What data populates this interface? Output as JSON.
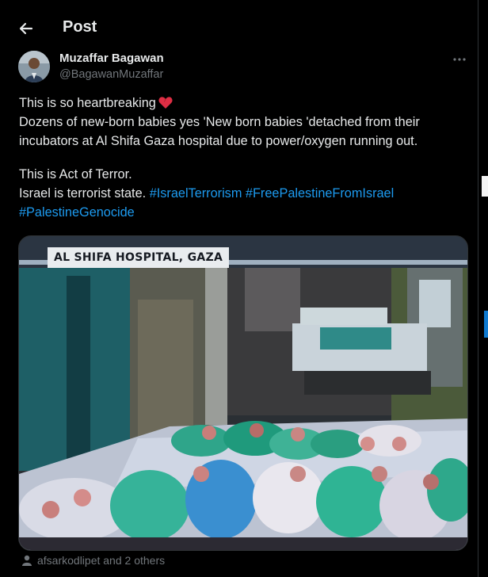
{
  "header": {
    "title": "Post"
  },
  "author": {
    "name": "Muzaffar Bagawan",
    "handle": "@BagawanMuzaffar"
  },
  "post": {
    "line1": "This is so heartbreaking",
    "line2": "Dozens of new-born babies yes 'New born babies 'detached from their",
    "line3": "incubators at Al Shifa Gaza hospital due to power/oxygen running out.",
    "line4": "This is Act of Terror.",
    "line5_prefix": "Israel is terrorist state.",
    "hashtags": [
      "#IsraelTerrorism",
      "#FreePalestineFromIsrael",
      "#PalestineGenocide"
    ]
  },
  "media": {
    "caption": "AL SHIFA HOSPITAL, GAZA"
  },
  "likes": {
    "text": "afsarkodlipet and 2 others"
  },
  "icons": {
    "back": "arrow-left-icon",
    "more": "more-dots-icon",
    "heart": "broken-heart-emoji",
    "liked": "avatar-icon"
  },
  "colors": {
    "link": "#1d9bf0",
    "muted": "#71767b",
    "text": "#e7e9ea",
    "background": "#000000"
  }
}
